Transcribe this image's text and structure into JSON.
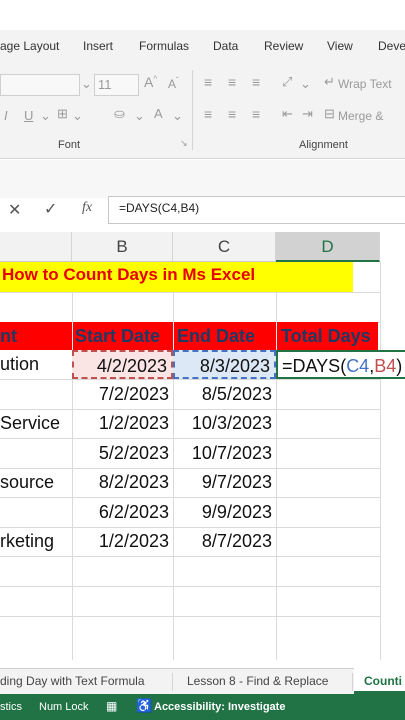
{
  "ribbon": {
    "tabs": [
      "age Layout",
      "Insert",
      "Formulas",
      "Data",
      "Review",
      "View",
      "Devel"
    ],
    "font_size": "11",
    "wrap_text": "Wrap Text",
    "merge": "Merge &",
    "group_font": "Font",
    "group_alignment": "Alignment"
  },
  "formula_bar": {
    "formula": "=DAYS(C4,B4)"
  },
  "grid": {
    "columns": [
      "B",
      "C",
      "D"
    ],
    "title": "How to Count Days in Ms Excel",
    "headers": [
      "nt",
      "Start Date",
      "End Date",
      "Total Days"
    ],
    "rows": [
      {
        "a": "ution",
        "b": "4/2/2023",
        "c": "8/3/2023",
        "d": "=DAYS(C4,B4)"
      },
      {
        "a": "",
        "b": "7/2/2023",
        "c": "8/5/2023",
        "d": ""
      },
      {
        "a": "Service",
        "b": "1/2/2023",
        "c": "10/3/2023",
        "d": ""
      },
      {
        "a": "",
        "b": "5/2/2023",
        "c": "10/7/2023",
        "d": ""
      },
      {
        "a": "source",
        "b": "8/2/2023",
        "c": "9/7/2023",
        "d": ""
      },
      {
        "a": "",
        "b": "6/2/2023",
        "c": "9/9/2023",
        "d": ""
      },
      {
        "a": "rketing",
        "b": "1/2/2023",
        "c": "8/7/2023",
        "d": ""
      }
    ],
    "edit_formula_parts": [
      "=DAYS(",
      "C4",
      ",",
      "B4",
      ")"
    ]
  },
  "sheet_tabs": [
    "ding Day with Text Formula",
    "Lesson 8 - Find & Replace",
    "Counti"
  ],
  "status": {
    "stats": "stics",
    "numlock": "Num Lock",
    "accessibility": "Accessibility: Investigate"
  },
  "colors": {
    "title_bg": "#ffff00",
    "title_text": "#e60000",
    "header_bg": "#ff0000",
    "header_text": "#1f3864",
    "ref_c4": "#4472c4",
    "ref_b4": "#c0504d",
    "status_bg": "#217346"
  }
}
